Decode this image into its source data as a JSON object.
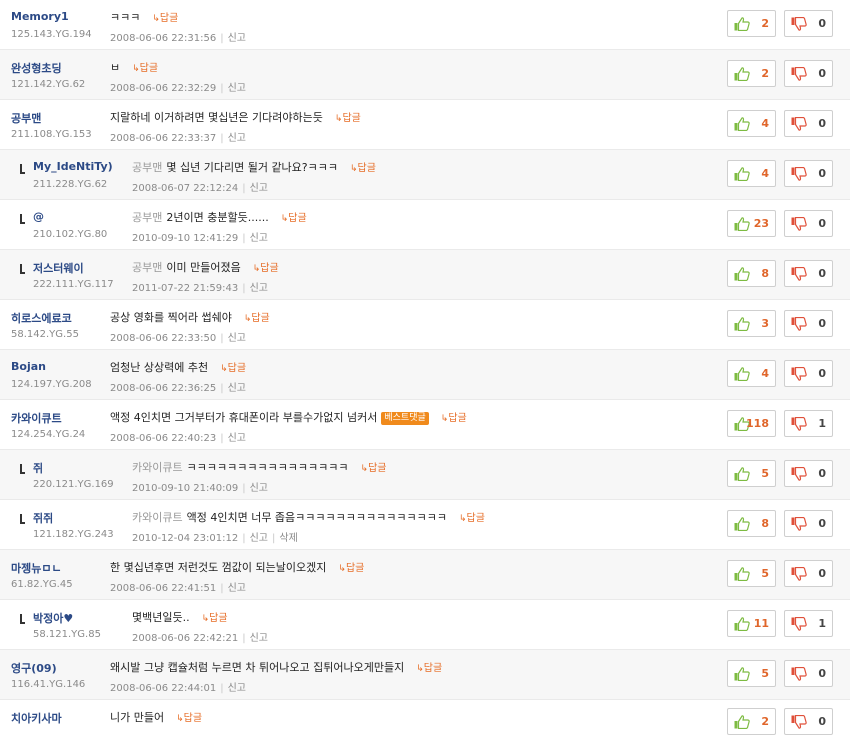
{
  "reply_label": "답글",
  "report_label": "신고",
  "delete_label": "삭제",
  "comments": [
    {
      "nick": "Memory1",
      "ip": "125.143.YG.194",
      "text": "ㅋㅋㅋ",
      "date": "2008-06-06 22:31:56",
      "up": "2",
      "down": "0"
    },
    {
      "nick": "완성형초딩",
      "ip": "121.142.YG.62",
      "text": "ㅂ",
      "date": "2008-06-06 22:32:29",
      "up": "2",
      "down": "0"
    },
    {
      "nick": "공부맨",
      "ip": "211.108.YG.153",
      "text": "지랄하네 이거하려면 몇십년은 기다려야하는듯",
      "date": "2008-06-06 22:33:37",
      "up": "4",
      "down": "0"
    },
    {
      "nick": "My_IdeNtiTy)",
      "ip": "211.228.YG.62",
      "parent": "공부맨",
      "text": "몇 십년 기다리면 될거 같나요?ㅋㅋㅋ",
      "date": "2008-06-07 22:12:24",
      "up": "4",
      "down": "0"
    },
    {
      "nick": "@",
      "ip": "210.102.YG.80",
      "parent": "공부맨",
      "text": "2년이면 충분할듯......",
      "date": "2010-09-10 12:41:29",
      "up": "23",
      "down": "0"
    },
    {
      "nick": "저스터웨이",
      "ip": "222.111.YG.117",
      "parent": "공부맨",
      "text": "이미 만들어졌음",
      "date": "2011-07-22 21:59:43",
      "up": "8",
      "down": "0"
    },
    {
      "nick": "히로스에료코",
      "ip": "58.142.YG.55",
      "text": "공상 영화를 찍어라 썹쉐야",
      "date": "2008-06-06 22:33:50",
      "up": "3",
      "down": "0"
    },
    {
      "nick": "Bojan",
      "ip": "124.197.YG.208",
      "text": "엄청난 상상력에 추천",
      "date": "2008-06-06 22:36:25",
      "up": "4",
      "down": "0"
    },
    {
      "nick": "카와이큐트",
      "ip": "124.254.YG.24",
      "text": "액정 4인치면 그거부터가 휴대폰이라 부를수가없지 넘커서",
      "best": "베스트댓글",
      "date": "2008-06-06 22:40:23",
      "up": "118",
      "down": "1"
    },
    {
      "nick": "쥐",
      "ip": "220.121.YG.169",
      "parent": "카와이큐트",
      "text": "ㅋㅋㅋㅋㅋㅋㅋㅋㅋㅋㅋㅋㅋㅋㅋㅋ",
      "date": "2010-09-10 21:40:09",
      "up": "5",
      "down": "0"
    },
    {
      "nick": "쥐쥐",
      "ip": "121.182.YG.243",
      "parent": "카와이큐트",
      "text": "액정 4인치면 너무 좁음ㅋㅋㅋㅋㅋㅋㅋㅋㅋㅋㅋㅋㅋㅋㅋ",
      "date": "2010-12-04 23:01:12",
      "deletable": true,
      "up": "8",
      "down": "0"
    },
    {
      "nick": "마젱뉴ㅁㄴ",
      "ip": "61.82.YG.45",
      "text": "한 몇십년후면 저런것도 껌값이 되는날이오겠지",
      "date": "2008-06-06 22:41:51",
      "up": "5",
      "down": "0"
    },
    {
      "nick": "박정아♥",
      "ip": "58.121.YG.85",
      "parent": "",
      "text": "몇백년일듯..",
      "date": "2008-06-06 22:42:21",
      "up": "11",
      "down": "1"
    },
    {
      "nick": "영구(09)",
      "ip": "116.41.YG.146",
      "text": "왜시발 그냥 캡슐처럼 누르면 차 튀어나오고 집튀어나오게만들지",
      "date": "2008-06-06 22:44:01",
      "up": "5",
      "down": "0"
    },
    {
      "nick": "치아키사마",
      "ip": "",
      "text": "니가 만들어",
      "date": "",
      "up": "2",
      "down": "0"
    }
  ]
}
